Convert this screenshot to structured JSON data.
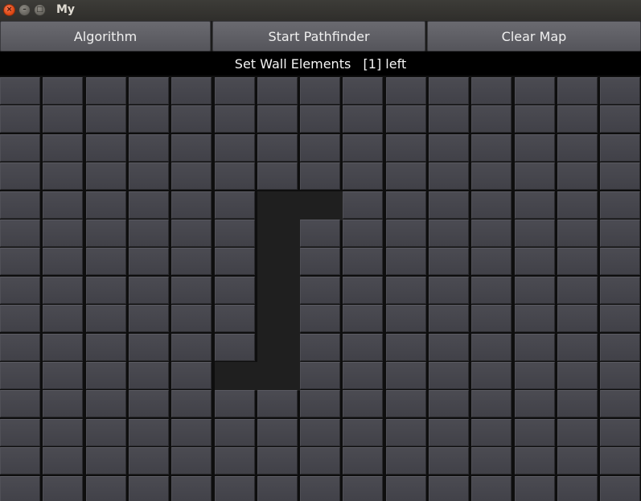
{
  "window": {
    "title": "My",
    "close_glyph": "×",
    "minimize_glyph": "–",
    "maximize_glyph": "□"
  },
  "toolbar": {
    "algorithm_label": "Algorithm",
    "start_label": "Start Pathfinder",
    "clear_label": "Clear Map"
  },
  "status": {
    "text": "Set Wall Elements   [1] left"
  },
  "grid": {
    "columns": 15,
    "rows": 15,
    "walls": [
      [
        4,
        6
      ],
      [
        4,
        7
      ],
      [
        5,
        6
      ],
      [
        6,
        6
      ],
      [
        7,
        6
      ],
      [
        8,
        6
      ],
      [
        9,
        6
      ],
      [
        10,
        5
      ],
      [
        10,
        6
      ]
    ]
  }
}
